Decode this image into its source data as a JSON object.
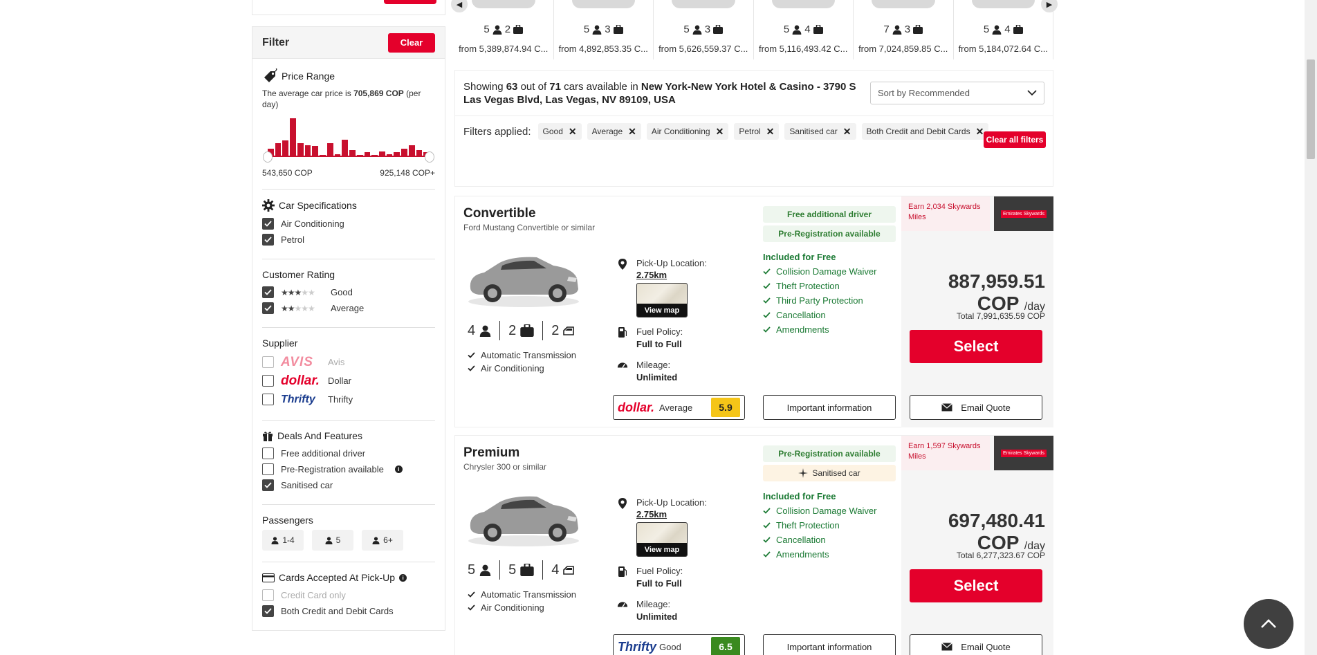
{
  "sidebar": {
    "filter_title": "Filter",
    "clear_label": "Clear",
    "price_range": {
      "title": "Price Range",
      "avg_prefix": "The average car price is",
      "avg_value": "705,869 COP",
      "avg_suffix": "(per day)",
      "histogram": [
        0.22,
        0.35,
        0.42,
        1.0,
        0.35,
        0.3,
        0.28,
        0.05,
        0.35,
        0.08,
        0.45,
        0.18,
        0.05,
        0.12,
        0.06,
        0.14,
        0.08,
        0.12,
        0.22,
        0.3,
        0.18,
        0.12
      ],
      "min": "543,650 COP",
      "max": "925,148 COP+"
    },
    "car_specs": {
      "title": "Car Specifications",
      "items": [
        {
          "label": "Air Conditioning"
        },
        {
          "label": "Petrol"
        }
      ]
    },
    "customer_rating": {
      "title": "Customer Rating",
      "items": [
        {
          "label": "Good",
          "stars": 3
        },
        {
          "label": "Average",
          "stars": 2
        }
      ]
    },
    "supplier": {
      "title": "Supplier",
      "items": [
        {
          "logo": "AVIS",
          "label": "Avis"
        },
        {
          "logo": "dollar.",
          "label": "Dollar"
        },
        {
          "logo": "Thrifty",
          "label": "Thrifty"
        }
      ]
    },
    "deals": {
      "title": "Deals And Features",
      "items": [
        {
          "label": "Free additional driver"
        },
        {
          "label": "Pre-Registration available"
        },
        {
          "label": "Sanitised car"
        }
      ]
    },
    "passengers": {
      "title": "Passengers",
      "options": [
        "1-4",
        "5",
        "6+"
      ]
    },
    "cards": {
      "title": "Cards Accepted At Pick-Up",
      "items": [
        {
          "label": "Credit Card only"
        },
        {
          "label": "Both Credit and Debit Cards"
        }
      ]
    }
  },
  "carousel": [
    {
      "pax": "5",
      "bags": "2",
      "price": "from 5,389,874.94 C..."
    },
    {
      "pax": "5",
      "bags": "3",
      "price": "from 4,892,853.35 C..."
    },
    {
      "pax": "5",
      "bags": "3",
      "price": "from 5,626,559.37 C..."
    },
    {
      "pax": "5",
      "bags": "4",
      "price": "from 5,116,493.42 C..."
    },
    {
      "pax": "7",
      "bags": "3",
      "price": "from 7,024,859.85 C..."
    },
    {
      "pax": "5",
      "bags": "4",
      "price": "from 5,184,072.64 C..."
    }
  ],
  "results": {
    "showing_prefix": "Showing",
    "shown": "63",
    "out_of": "out of",
    "total": "71",
    "available_in": "cars available in",
    "location": "New York-New York Hotel & Casino - 3790 S Las Vegas Blvd, Las Vegas, NV 89109, USA",
    "sort_label": "Sort by Recommended",
    "filters_label": "Filters applied:",
    "filters": [
      "Good",
      "Average",
      "Air Conditioning",
      "Petrol",
      "Sanitised car",
      "Both Credit and Debit Cards"
    ],
    "clear_all": "Clear all filters"
  },
  "cars": [
    {
      "category": "Convertible",
      "model": "Ford Mustang Convertible or similar",
      "pax": "4",
      "bags": "2",
      "doors": "2",
      "features": [
        "Automatic Transmission",
        "Air Conditioning"
      ],
      "pickup_label": "Pick-Up Location:",
      "distance": "2.75km",
      "view_map": "View map",
      "fuel_label": "Fuel Policy:",
      "fuel_value": "Full to Full",
      "mileage_label": "Mileage:",
      "mileage_value": "Unlimited",
      "badges": [
        {
          "text": "Free additional driver"
        },
        {
          "text": "Pre-Registration available"
        }
      ],
      "included_title": "Included for Free",
      "included": [
        "Collision Damage Waiver",
        "Theft Protection",
        "Third Party Protection",
        "Cancellation",
        "Amendments"
      ],
      "supplier_logo": "dollar.",
      "rating_text": "Average",
      "rating_score": "5.9",
      "rating_color": "#f5c518",
      "important": "Important information",
      "skywards": "Earn 2,034 Skywards Miles",
      "skywards_logo": "Emirates Skywards",
      "price": "887,959.51",
      "currency": "COP",
      "per": "/day",
      "total": "Total 7,991,635.59 COP",
      "select": "Select",
      "email": "Email Quote"
    },
    {
      "category": "Premium",
      "model": "Chrysler 300 or similar",
      "pax": "5",
      "bags": "5",
      "doors": "4",
      "features": [
        "Automatic Transmission",
        "Air Conditioning"
      ],
      "pickup_label": "Pick-Up Location:",
      "distance": "2.75km",
      "view_map": "View map",
      "fuel_label": "Fuel Policy:",
      "fuel_value": "Full to Full",
      "mileage_label": "Mileage:",
      "mileage_value": "Unlimited",
      "badges": [
        {
          "text": "Pre-Registration available"
        },
        {
          "text": "Sanitised car"
        }
      ],
      "included_title": "Included for Free",
      "included": [
        "Collision Damage Waiver",
        "Theft Protection",
        "Cancellation",
        "Amendments"
      ],
      "supplier_logo": "Thrifty",
      "rating_text": "Good",
      "rating_score": "6.5",
      "rating_color": "#3a8a1f",
      "important": "Important information",
      "skywards": "Earn 1,597 Skywards Miles",
      "skywards_logo": "Emirates Skywards",
      "price": "697,480.41",
      "currency": "COP",
      "per": "/day",
      "total": "Total 6,277,323.67 COP",
      "select": "Select",
      "email": "Email Quote"
    }
  ]
}
